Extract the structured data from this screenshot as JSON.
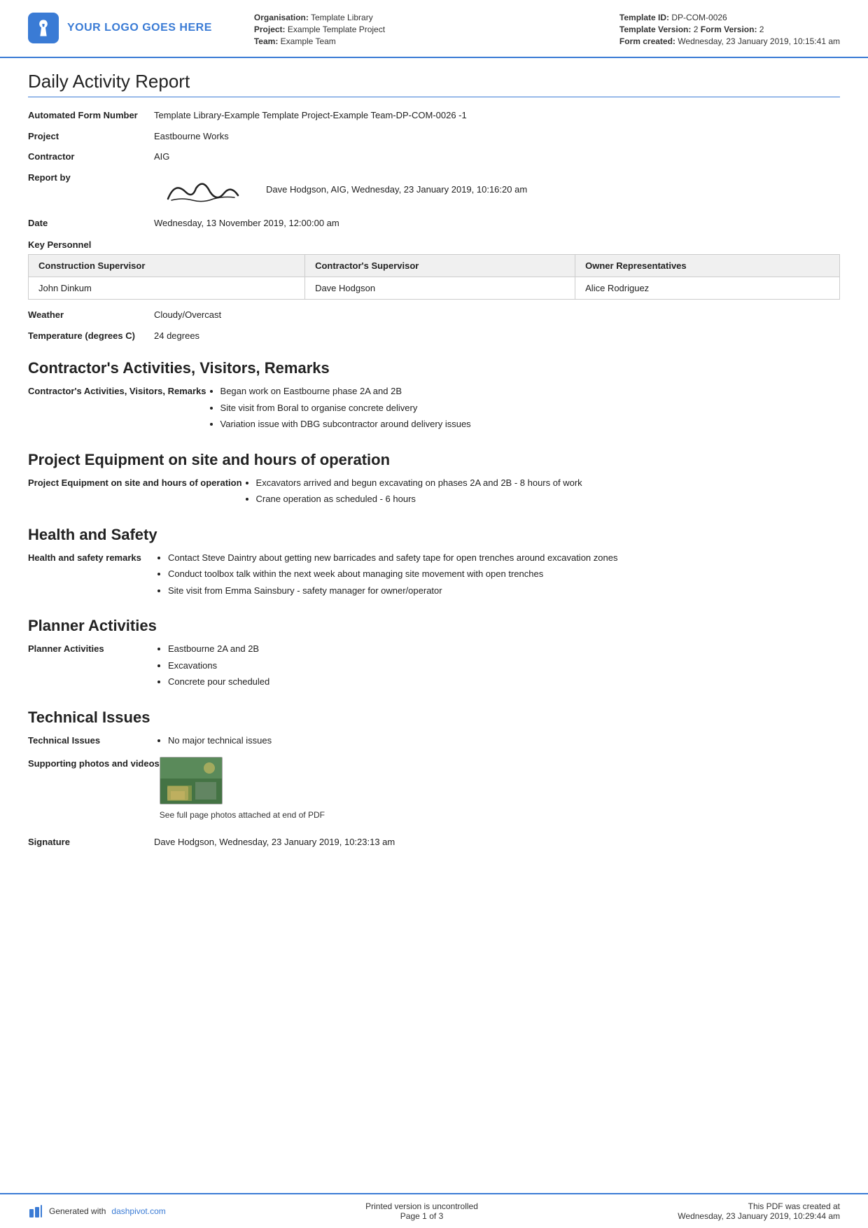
{
  "header": {
    "logo_text": "YOUR LOGO GOES HERE",
    "org_label": "Organisation:",
    "org_value": "Template Library",
    "project_label": "Project:",
    "project_value": "Example Template Project",
    "team_label": "Team:",
    "team_value": "Example Team",
    "template_id_label": "Template ID:",
    "template_id_value": "DP-COM-0026",
    "template_version_label": "Template Version:",
    "template_version_value": "2",
    "form_version_label": "Form Version:",
    "form_version_value": "2",
    "form_created_label": "Form created:",
    "form_created_value": "Wednesday, 23 January 2019, 10:15:41 am"
  },
  "report": {
    "title": "Daily Activity Report",
    "form_number_label": "Automated Form Number",
    "form_number_value": "Template Library-Example Template Project-Example Team-DP-COM-0026   -1",
    "project_label": "Project",
    "project_value": "Eastbourne Works",
    "contractor_label": "Contractor",
    "contractor_value": "AIG",
    "report_by_label": "Report by",
    "report_by_text": "Dave Hodgson, AIG, Wednesday, 23 January 2019, 10:16:20 am",
    "date_label": "Date",
    "date_value": "Wednesday, 13 November 2019, 12:00:00 am"
  },
  "key_personnel": {
    "label": "Key Personnel",
    "columns": [
      "Construction Supervisor",
      "Contractor's Supervisor",
      "Owner Representatives"
    ],
    "rows": [
      [
        "John Dinkum",
        "Dave Hodgson",
        "Alice Rodriguez"
      ]
    ]
  },
  "weather": {
    "label": "Weather",
    "value": "Cloudy/Overcast"
  },
  "temperature": {
    "label": "Temperature (degrees C)",
    "value": "24 degrees"
  },
  "sections": {
    "activities": {
      "heading": "Contractor's Activities, Visitors, Remarks",
      "field_label": "Contractor's Activities, Visitors, Remarks",
      "items": [
        "Began work on Eastbourne phase 2A and 2B",
        "Site visit from Boral to organise concrete delivery",
        "Variation issue with DBG subcontractor around delivery issues"
      ]
    },
    "equipment": {
      "heading": "Project Equipment on site and hours of operation",
      "field_label": "Project Equipment on site and hours of operation",
      "items": [
        "Excavators arrived and begun excavating on phases 2A and 2B - 8 hours of work",
        "Crane operation as scheduled - 6 hours"
      ]
    },
    "health_safety": {
      "heading": "Health and Safety",
      "field_label": "Health and safety remarks",
      "items": [
        "Contact Steve Daintry about getting new barricades and safety tape for open trenches around excavation zones",
        "Conduct toolbox talk within the next week about managing site movement with open trenches",
        "Site visit from Emma Sainsbury - safety manager for owner/operator"
      ]
    },
    "planner": {
      "heading": "Planner Activities",
      "field_label": "Planner Activities",
      "items": [
        "Eastbourne 2A and 2B",
        "Excavations",
        "Concrete pour scheduled"
      ]
    },
    "technical": {
      "heading": "Technical Issues",
      "field_label": "Technical Issues",
      "items": [
        "No major technical issues"
      ]
    }
  },
  "supporting": {
    "label": "Supporting photos and videos",
    "caption": "See full page photos attached at end of PDF"
  },
  "signature": {
    "label": "Signature",
    "value": "Dave Hodgson, Wednesday, 23 January 2019, 10:23:13 am"
  },
  "footer": {
    "generated_label": "Generated with",
    "generated_link": "dashpivot.com",
    "uncontrolled": "Printed version is uncontrolled",
    "page_label": "Page",
    "page_current": "1",
    "page_of": "of",
    "page_total": "3",
    "pdf_created_label": "This PDF was created at",
    "pdf_created_value": "Wednesday, 23 January 2019, 10:29:44 am"
  }
}
